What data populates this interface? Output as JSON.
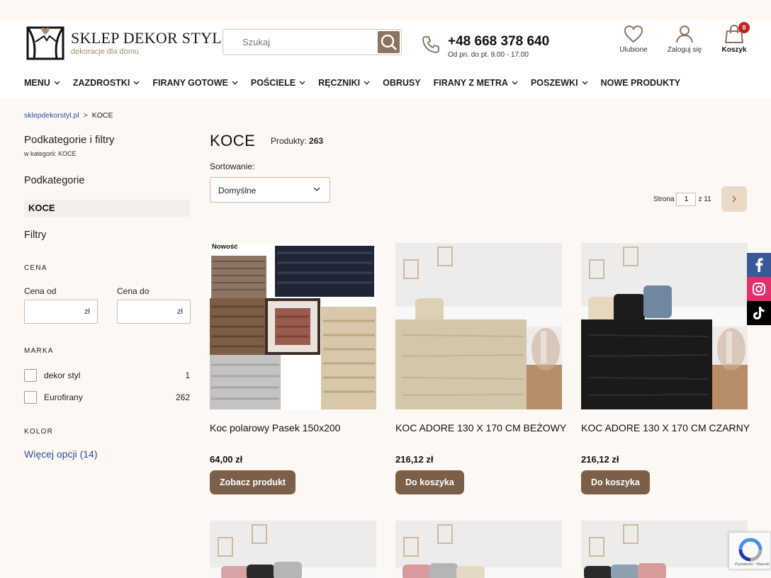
{
  "header": {
    "logo_title": "SKLEP DEKOR STYL",
    "logo_subtitle": "dekoracje dla domu",
    "search_placeholder": "Szukaj",
    "phone": "+48 668 378 640",
    "hours": "Od pn. do pt. 9.00 - 17.00",
    "favorites_label": "Ulubione",
    "login_label": "Zaloguj się",
    "cart_label": "Koszyk",
    "cart_count": "0"
  },
  "nav": [
    {
      "label": "MENU",
      "dropdown": true
    },
    {
      "label": "ZAZDROSTKI",
      "dropdown": true
    },
    {
      "label": "FIRANY GOTOWE",
      "dropdown": true
    },
    {
      "label": "POŚCIELE",
      "dropdown": true
    },
    {
      "label": "RĘCZNIKI",
      "dropdown": true
    },
    {
      "label": "OBRUSY",
      "dropdown": false
    },
    {
      "label": "FIRANY Z METRA",
      "dropdown": true
    },
    {
      "label": "POSZEWKI",
      "dropdown": true
    },
    {
      "label": "NOWE PRODUKTY",
      "dropdown": false
    }
  ],
  "breadcrumb": {
    "home": "sklepdekorstyl.pl",
    "separator": ">",
    "current": "KOCE"
  },
  "sidebar": {
    "title": "Podkategorie i filtry",
    "subtitle": "w kategorii: KOCE",
    "subcategories_heading": "Podkategorie",
    "active_subcategory": "KOCE",
    "filters_heading": "Filtry",
    "price_section": "CENA",
    "price_from_label": "Cena od",
    "price_to_label": "Cena do",
    "currency": "zł",
    "brand_section": "MARKA",
    "brands": [
      {
        "name": "dekor styl",
        "count": "1"
      },
      {
        "name": "Eurofirany",
        "count": "262"
      }
    ],
    "color_section": "KOLOR",
    "more_options": "Więcej opcji (14)"
  },
  "main": {
    "category_title": "KOCE",
    "products_label": "Produkty:",
    "products_count": "263",
    "sort_label": "Sortowanie:",
    "sort_value": "Domyślne",
    "page_label": "Strona",
    "page_current": "1",
    "page_total": "z 11"
  },
  "products": [
    {
      "badge": "Nowość",
      "name": "Koc polarowy Pasek 150x200",
      "price": "64,00 zł",
      "button": "Zobacz produkt"
    },
    {
      "badge": "",
      "name": "KOC ADORE 130 X 170 CM BEŻOWY",
      "price": "216,12 zł",
      "button": "Do koszyka"
    },
    {
      "badge": "",
      "name": "KOC ADORE 130 X 170 CM CZARNY",
      "price": "216,12 zł",
      "button": "Do koszyka"
    }
  ],
  "recaptcha_text": "Prywatność - Warunki",
  "social": [
    "facebook-icon",
    "instagram-icon",
    "tiktok-icon"
  ],
  "colors": {
    "accent_brown": "#7c5f49",
    "page_bg": "#fdf8f3",
    "link_blue": "#2a4fa0",
    "badge_red": "#c0231f"
  }
}
